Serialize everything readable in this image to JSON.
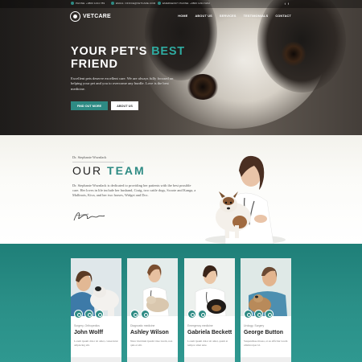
{
  "topbar": {
    "phone": "PHONE: +0800 1234 789",
    "email": "EMAIL: OFFICE@VETCARE.COM",
    "emergency": "EMERGENCY PHONE: +0800 1234 6232",
    "social": [
      "twitter-icon",
      "facebook-icon"
    ]
  },
  "nav": {
    "logo": "VETCARE",
    "items": [
      "HOME",
      "ABOUT US",
      "SERVICES",
      "TESTIMONIALS",
      "CONTACT"
    ]
  },
  "hero": {
    "title_part1": "YOUR PET'S",
    "title_accent": "BEST",
    "title_part2": "FRIEND",
    "text": "Excellent pets deserve excellent care. We are always fully focused on helping your pet and you to overcome any hurdle. Love is the best medicine.",
    "primary_button": "FIND OUT MORE",
    "secondary_button": "ABOUT US"
  },
  "team_intro": {
    "doctor_name": "Dr. Stephanie Woznlack",
    "title_part1": "OUR",
    "title_accent": "TEAM",
    "bio": "Dr. Stephanie Woznlack is dedicated to providing her patients with the best possible care. Her loves in life include her husband, Craig, two cattle dogs, Scoote and Kanga, a Mallinois, Kiva, and her two horses, Widget and Doc."
  },
  "team_cards": [
    {
      "specialty": "Surgery, Orthopedics",
      "name": "John Wolff",
      "desc": "Lorem ipsum dolor sit amet, consectetur adipiscing elit."
    },
    {
      "specialty": "Diagnostic medicine",
      "name": "Ashley Wilson",
      "desc": "Nunc tincidunt ipsum vitae lorem, non quis et elit."
    },
    {
      "specialty": "Emergency medicine",
      "name": "Gabriela Beckett",
      "desc": "Lorem ipsum dolor sit amet, quam at tempor amet ante."
    },
    {
      "specialty": "Urology, Surgery",
      "name": "George Button",
      "desc": "Suspendisse massa, at eu efficitur lorem ullamcorper id."
    }
  ],
  "colors": {
    "accent": "#2e8b84",
    "accent_light": "#2faaa0",
    "dark": "#2a2725"
  }
}
